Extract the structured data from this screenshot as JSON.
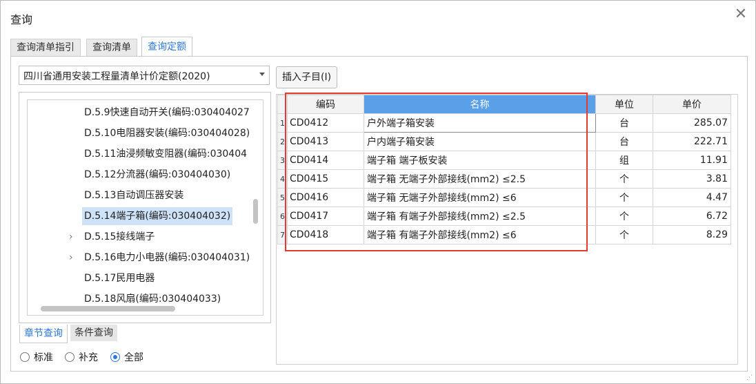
{
  "window": {
    "title": "查询"
  },
  "tabs": [
    {
      "label": "查询清单指引"
    },
    {
      "label": "查询清单"
    },
    {
      "label": "查询定额"
    }
  ],
  "library_select": {
    "value": "四川省通用安装工程量清单计价定额(2020)"
  },
  "insert_button": {
    "label": "插入子目(I)"
  },
  "tree": {
    "items": [
      {
        "label": "D.5.9快速自动开关(编码:030404027"
      },
      {
        "label": "D.5.10电阻器安装(编码:030404028)"
      },
      {
        "label": "D.5.11油浸频敏变阻器(编码:030404"
      },
      {
        "label": "D.5.12分流器(编码:030404030)"
      },
      {
        "label": "D.5.13自动调压器安装"
      },
      {
        "label": "D.5.14端子箱(编码:030404032)"
      },
      {
        "label": "D.5.15接线端子"
      },
      {
        "label": "D.5.16电力小电器(编码:030404031)"
      },
      {
        "label": "D.5.17民用电器"
      },
      {
        "label": "D.5.18风扇(编码:030404033)"
      }
    ],
    "selected_index": 5
  },
  "subtabs": [
    {
      "label": "章节查询"
    },
    {
      "label": "条件查询"
    }
  ],
  "radios": [
    {
      "label": "标准"
    },
    {
      "label": "补充"
    },
    {
      "label": "全部"
    }
  ],
  "grid": {
    "headers": {
      "code": "编码",
      "name": "名称",
      "unit": "单位",
      "price": "单价"
    },
    "rows": [
      {
        "idx": "1",
        "code": "CD0412",
        "name": "户外端子箱安装",
        "unit": "台",
        "price": "285.07"
      },
      {
        "idx": "2",
        "code": "CD0413",
        "name": "户内端子箱安装",
        "unit": "台",
        "price": "222.71"
      },
      {
        "idx": "3",
        "code": "CD0414",
        "name": "端子箱 端子板安装",
        "unit": "组",
        "price": "11.91"
      },
      {
        "idx": "4",
        "code": "CD0415",
        "name": "端子箱 无端子外部接线(mm2) ≤2.5",
        "unit": "个",
        "price": "3.81"
      },
      {
        "idx": "5",
        "code": "CD0416",
        "name": "端子箱 无端子外部接线(mm2) ≤6",
        "unit": "个",
        "price": "4.47"
      },
      {
        "idx": "6",
        "code": "CD0417",
        "name": "端子箱 有端子外部接线(mm2) ≤2.5",
        "unit": "个",
        "price": "6.72"
      },
      {
        "idx": "7",
        "code": "CD0418",
        "name": "端子箱 有端子外部接线(mm2) ≤6",
        "unit": "个",
        "price": "8.29"
      }
    ]
  },
  "colors": {
    "accent": "#2f78d6",
    "header_highlight": "#5aa0e8",
    "selection": "#cfe3f8",
    "annotation_box": "#e53935"
  }
}
